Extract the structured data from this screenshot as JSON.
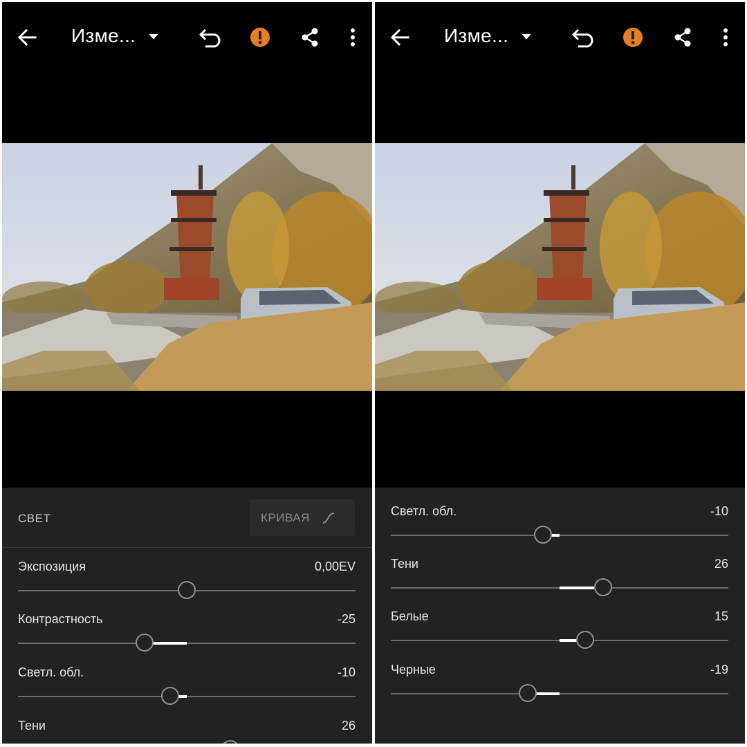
{
  "screens": [
    {
      "title": "Изме...",
      "section": {
        "title": "СВЕТ",
        "curve_button": "КРИВАЯ"
      },
      "controls": [
        {
          "label": "Экспозиция",
          "value": "0,00EV",
          "position": 0.5
        },
        {
          "label": "Контрастность",
          "value": "-25",
          "position": 0.375
        },
        {
          "label": "Светл. обл.",
          "value": "-10",
          "position": 0.45
        },
        {
          "label": "Тени",
          "value": "26",
          "position": 0.63
        }
      ]
    },
    {
      "title": "Изме...",
      "controls": [
        {
          "label": "Светл. обл.",
          "value": "-10",
          "position": 0.45
        },
        {
          "label": "Тени",
          "value": "26",
          "position": 0.63
        },
        {
          "label": "Белые",
          "value": "15",
          "position": 0.575
        },
        {
          "label": "Черные",
          "value": "-19",
          "position": 0.405
        }
      ]
    }
  ],
  "icons": {
    "back": "arrow-left-icon",
    "undo": "undo-icon",
    "warning": "warning-icon",
    "share": "share-icon",
    "more": "more-vert-icon",
    "dropdown": "caret-down-icon",
    "curve": "curve-icon"
  },
  "colors": {
    "warning": "#e67e22",
    "panel_bg": "#222222",
    "track": "#6d6d6d",
    "fill": "#ffffff"
  }
}
